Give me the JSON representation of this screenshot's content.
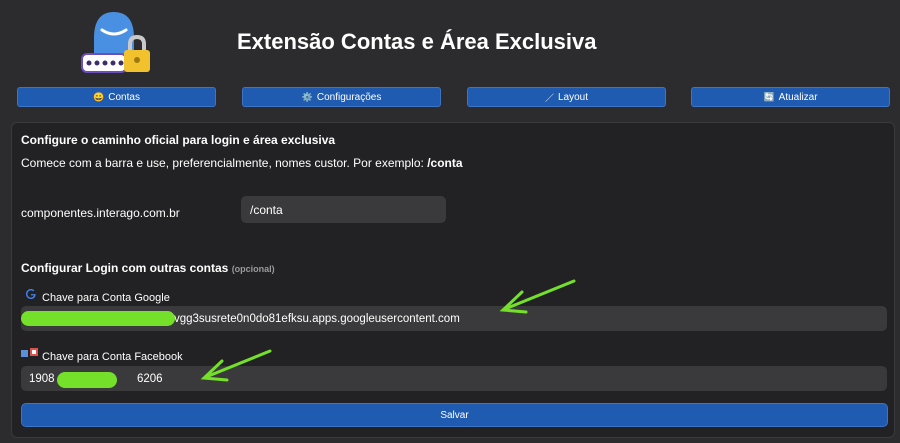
{
  "header": {
    "title": "Extensão Contas e Área Exclusiva",
    "logo_icon": "user-lock-icon"
  },
  "tabs": [
    {
      "icon": "😀",
      "label": "Contas"
    },
    {
      "icon": "⚙️",
      "label": "Configurações"
    },
    {
      "icon": "／",
      "label": "Layout"
    },
    {
      "icon": "🔄",
      "label": "Atualizar"
    }
  ],
  "config": {
    "heading": "Configure o caminho oficial para login e área exclusiva",
    "description": "Comece com a barra e use, preferencialmente, nomes custor. Por exemplo: ",
    "example": "/conta",
    "domain": "componentes.interago.com.br",
    "path_value": "/conta"
  },
  "login": {
    "heading": "Configurar Login com outras contas ",
    "optional": "(opcional)",
    "google_label": "Chave para Conta Google",
    "google_value": "vgg3susrete0n0do81efksu.apps.googleusercontent.com",
    "facebook_label": "Chave para Conta Facebook",
    "facebook_value_start": "1908",
    "facebook_value_end": "6206"
  },
  "save_label": "Salvar",
  "colors": {
    "background": "#2c2c2e",
    "panel": "#222224",
    "button": "#1f5bb0",
    "input": "#3a3a3c",
    "highlight": "#74e02a"
  }
}
